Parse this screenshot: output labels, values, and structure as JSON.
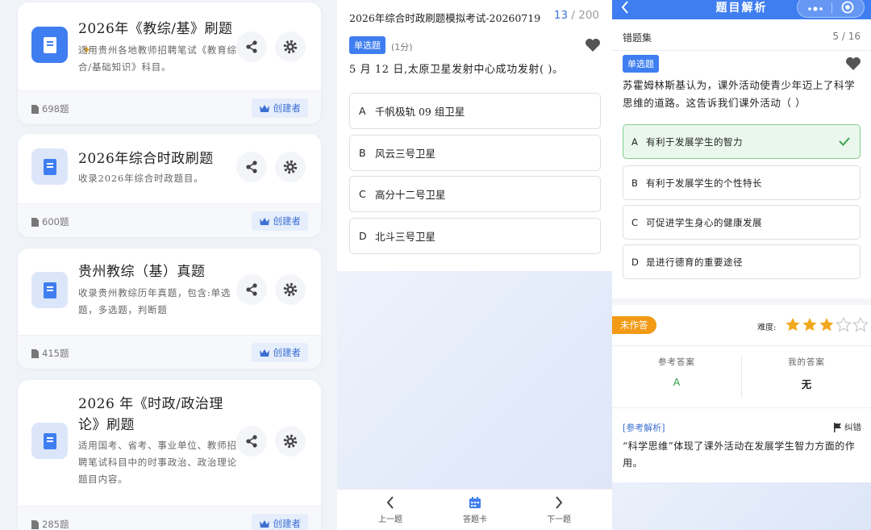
{
  "bank_list": {
    "creator_label": "创建者",
    "cards": [
      {
        "title": "2026年《教综/基》刷题",
        "pinned": true,
        "description": "适用贵州各地教师招聘笔试《教育综合/基础知识》科目。",
        "count": "698题"
      },
      {
        "title": "2026年综合时政刷题",
        "pinned": false,
        "description": "收录2026年综合时政题目。",
        "count": "600题"
      },
      {
        "title": "贵州教综（基）真题",
        "pinned": false,
        "description": "收录贵州教综历年真题，包含:单选题，多选题，判断题",
        "count": "415题"
      },
      {
        "title": "2026 年《时政/政治理论》刷题",
        "pinned": false,
        "description": "适用国考、省考、事业单位、教师招聘笔试科目中的时事政治、政治理论题目内容。",
        "count": "285题"
      }
    ]
  },
  "exam": {
    "title": "2026年综合时政刷题模拟考试-20260719",
    "current": "13",
    "total": "/ 200",
    "question_type": "单选题",
    "score": "(1分)",
    "question": "5 月 12 日,太原卫星发射中心成功发射( )。",
    "options": [
      {
        "letter": "A",
        "text": "千帆极轨 09 组卫星"
      },
      {
        "letter": "B",
        "text": "风云三号卫星"
      },
      {
        "letter": "C",
        "text": "高分十二号卫星"
      },
      {
        "letter": "D",
        "text": "北斗三号卫星"
      }
    ],
    "nav": {
      "prev": "上一题",
      "card": "答题卡",
      "next": "下一题"
    }
  },
  "analysis": {
    "title": "题目解析",
    "set_name": "错题集",
    "progress": "5 / 16",
    "question_type": "单选题",
    "question": "苏霍姆林斯基认为，课外活动使青少年迈上了科学思维的道路。这告诉我们课外活动（ ）",
    "options": [
      {
        "letter": "A",
        "text": "有利于发展学生的智力",
        "correct": true
      },
      {
        "letter": "B",
        "text": "有利于发展学生的个性特长",
        "correct": false
      },
      {
        "letter": "C",
        "text": "可促进学生身心的健康发展",
        "correct": false
      },
      {
        "letter": "D",
        "text": "是进行德育的重要途径",
        "correct": false
      }
    ],
    "status": "未作答",
    "difficulty_label": "难度:",
    "difficulty": 3,
    "difficulty_max": 5,
    "ref_answer_label": "参考答案",
    "ref_answer": "A",
    "my_answer_label": "我的答案",
    "my_answer": "无",
    "explanation_heading": "[参考解析]",
    "report_label": "纠错",
    "explanation": "“科学思维”体现了课外活动在发展学生智力方面的作用。"
  },
  "colors": {
    "primary": "#3f7ef0",
    "accent_gold": "#e0a322",
    "success": "#2e9f45",
    "warning": "#f39a16",
    "star": "#f2a81d"
  }
}
